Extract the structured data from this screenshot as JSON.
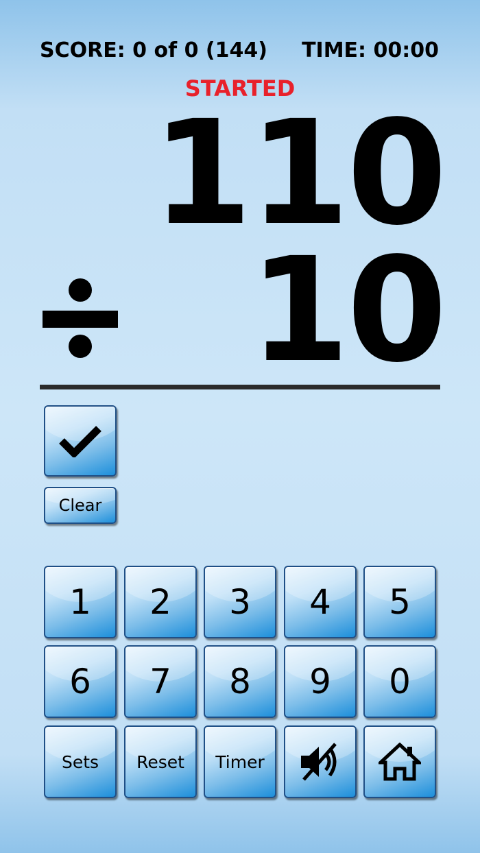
{
  "header": {
    "score": "SCORE: 0 of 0 (144)",
    "time": "TIME: 00:00",
    "status": "STARTED"
  },
  "problem": {
    "dividend": "110",
    "divisor": "10",
    "operator_icon": "division-icon"
  },
  "controls": {
    "check_icon": "checkmark-icon",
    "clear_label": "Clear"
  },
  "keypad": {
    "row1": [
      "1",
      "2",
      "3",
      "4",
      "5"
    ],
    "row2": [
      "6",
      "7",
      "8",
      "9",
      "0"
    ],
    "sets_label": "Sets",
    "reset_label": "Reset",
    "timer_label": "Timer",
    "mute_icon": "sound-muted-icon",
    "home_icon": "home-icon"
  },
  "colors": {
    "status": "#e8212b",
    "button_border": "#1f4f86",
    "button_blue": "#1d8fdb"
  }
}
